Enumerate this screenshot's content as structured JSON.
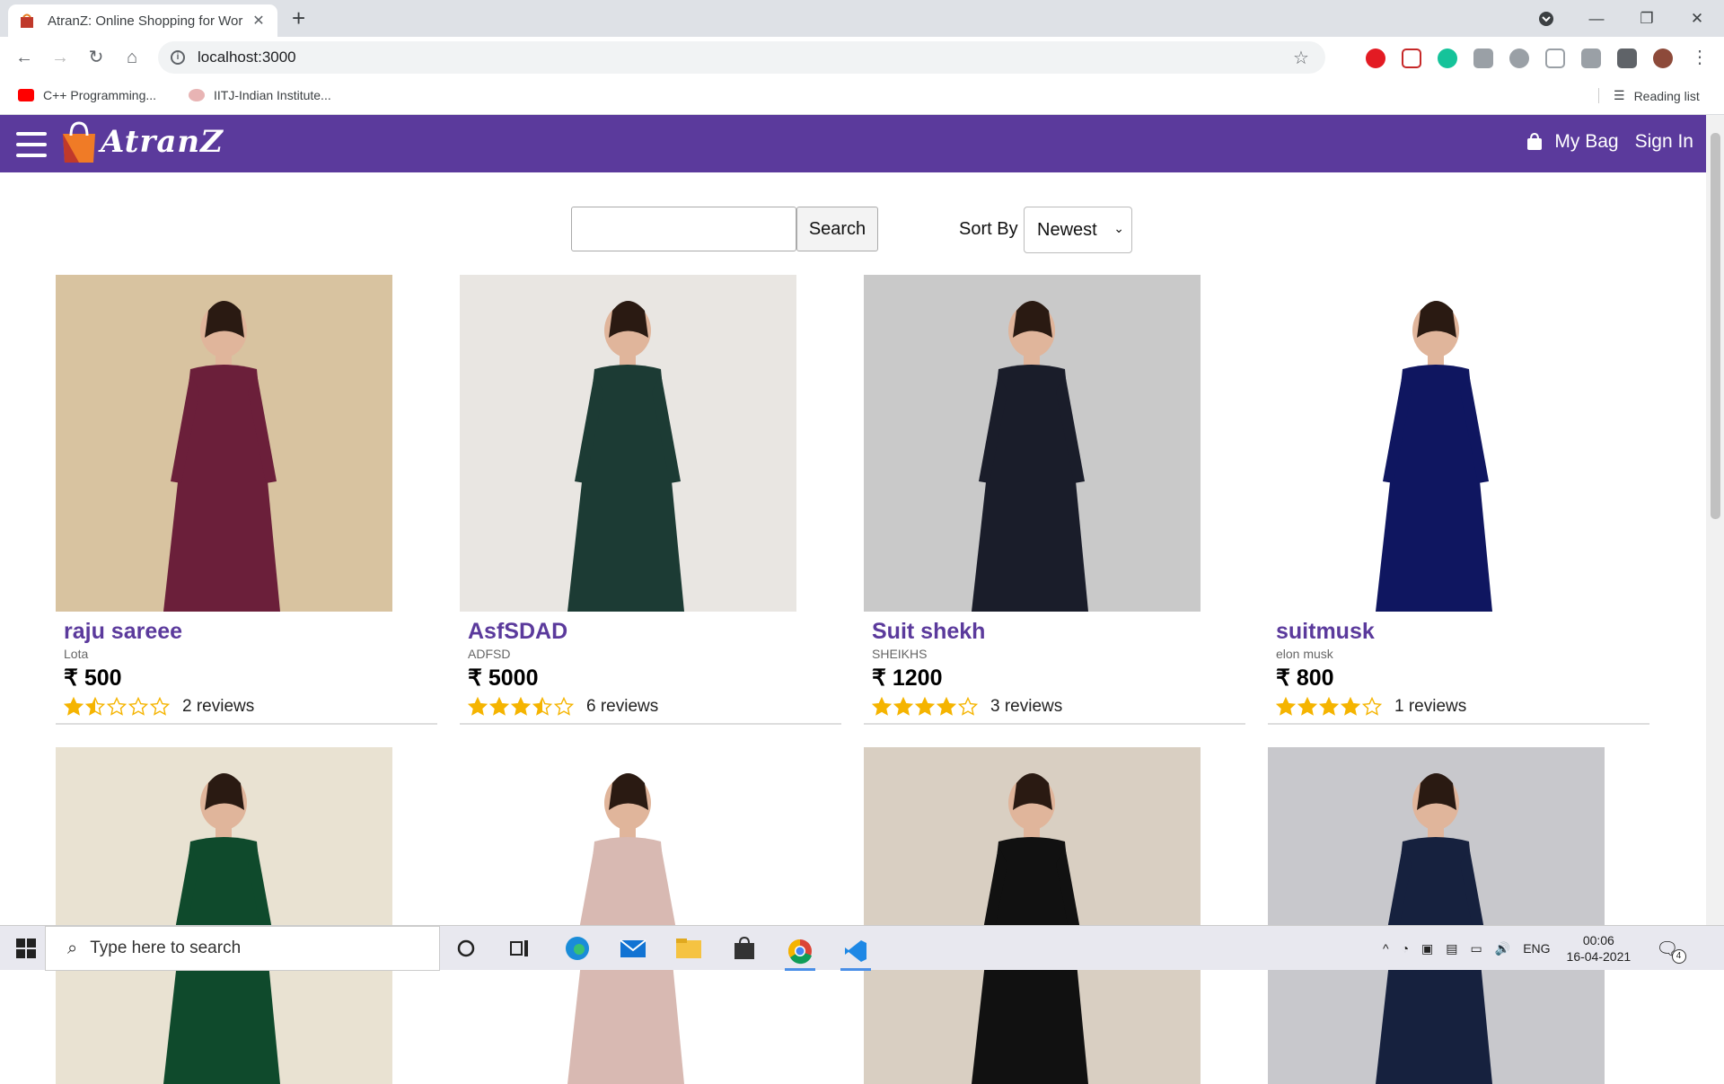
{
  "browser": {
    "tab_title": "AtranZ: Online Shopping for Wor",
    "url": "localhost:3000",
    "bookmarks": [
      "C++ Programming...",
      "IITJ-Indian Institute..."
    ],
    "reading_list": "Reading list"
  },
  "header": {
    "logo": "AtranZ",
    "my_bag": "My Bag",
    "sign_in": "Sign In"
  },
  "search": {
    "button": "Search",
    "value": "",
    "sort_label": "Sort By",
    "sort_value": "Newest"
  },
  "products": [
    {
      "name": "raju sareee",
      "brand": "Lota",
      "price": "₹ 500",
      "rating": 1.5,
      "reviews": "2 reviews",
      "colors": [
        "#d8c3a0",
        "#6b1f3a"
      ]
    },
    {
      "name": "AsfSDAD",
      "brand": "ADFSD",
      "price": "₹ 5000",
      "rating": 3.5,
      "reviews": "6 reviews",
      "colors": [
        "#e9e6e2",
        "#1c3b34"
      ]
    },
    {
      "name": "Suit shekh",
      "brand": "SHEIKHS",
      "price": "₹ 1200",
      "rating": 4,
      "reviews": "3 reviews",
      "colors": [
        "#c9c9c9",
        "#1a1d2a"
      ]
    },
    {
      "name": "suitmusk",
      "brand": "elon musk",
      "price": "₹ 800",
      "rating": 4,
      "reviews": "1 reviews",
      "colors": [
        "#ffffff",
        "#0f1660"
      ]
    },
    {
      "name": "",
      "brand": "",
      "price": "",
      "rating": 0,
      "reviews": "",
      "colors": [
        "#e9e2d2",
        "#0f4a2c"
      ]
    },
    {
      "name": "",
      "brand": "",
      "price": "",
      "rating": 0,
      "reviews": "",
      "colors": [
        "#ffffff",
        "#d8b9b2"
      ]
    },
    {
      "name": "",
      "brand": "",
      "price": "",
      "rating": 0,
      "reviews": "",
      "colors": [
        "#d9cfc2",
        "#111111"
      ]
    },
    {
      "name": "",
      "brand": "",
      "price": "",
      "rating": 0,
      "reviews": "",
      "colors": [
        "#c8c8cc",
        "#16213e"
      ]
    }
  ],
  "taskbar": {
    "search_placeholder": "Type here to search",
    "lang": "ENG",
    "time": "00:06",
    "date": "16-04-2021",
    "notifications": "4"
  },
  "theme": {
    "header_bg": "#5b3a9c",
    "star": "#f5b400"
  }
}
